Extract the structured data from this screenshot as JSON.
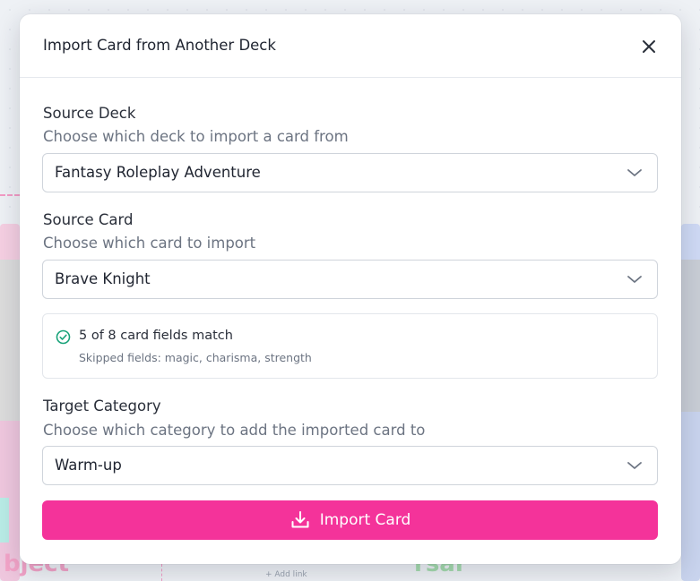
{
  "background": {
    "word_left": "bject",
    "word_right": "rsar",
    "link_text": "+ Add link"
  },
  "modal": {
    "title": "Import Card from Another Deck",
    "close_icon": "close-icon",
    "source_deck": {
      "label": "Source Deck",
      "help": "Choose which deck to import a card from",
      "value": "Fantasy Roleplay Adventure"
    },
    "source_card": {
      "label": "Source Card",
      "help": "Choose which card to import",
      "value": "Brave Knight"
    },
    "match": {
      "icon": "check-circle-icon",
      "title": "5 of 8 card fields match",
      "skipped": "Skipped fields: magic, charisma, strength"
    },
    "target_category": {
      "label": "Target Category",
      "help": "Choose which category to add the imported card to",
      "value": "Warm-up"
    },
    "import_button": {
      "label": "Import Card",
      "icon": "download-icon"
    }
  },
  "colors": {
    "accent": "#f4339a",
    "success": "#1aa37a",
    "muted_text": "#6c7482"
  }
}
